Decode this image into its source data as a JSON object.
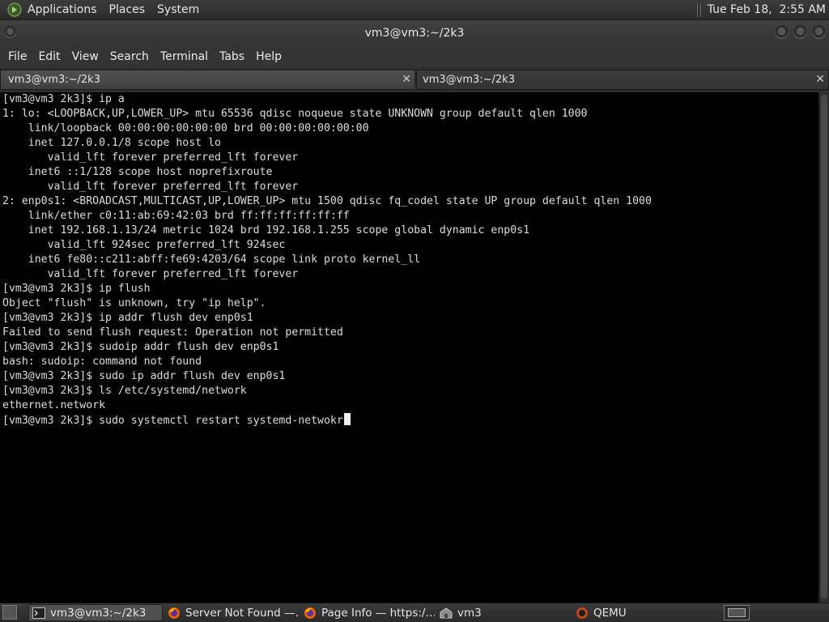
{
  "top_panel": {
    "menus": [
      "Applications",
      "Places",
      "System"
    ],
    "clock": "Tue Feb 18,  2:55 AM"
  },
  "window": {
    "title": "vm3@vm3:~/2k3",
    "menu": [
      "File",
      "Edit",
      "View",
      "Search",
      "Terminal",
      "Tabs",
      "Help"
    ],
    "tabs": [
      {
        "label": "vm3@vm3:~/2k3",
        "close": "✕"
      },
      {
        "label": "vm3@vm3:~/2k3",
        "close": "✕"
      }
    ]
  },
  "terminal": {
    "lines": [
      "[vm3@vm3 2k3]$ ip a",
      "1: lo: <LOOPBACK,UP,LOWER_UP> mtu 65536 qdisc noqueue state UNKNOWN group default qlen 1000",
      "    link/loopback 00:00:00:00:00:00 brd 00:00:00:00:00:00",
      "    inet 127.0.0.1/8 scope host lo",
      "       valid_lft forever preferred_lft forever",
      "    inet6 ::1/128 scope host noprefixroute",
      "       valid_lft forever preferred_lft forever",
      "2: enp0s1: <BROADCAST,MULTICAST,UP,LOWER_UP> mtu 1500 qdisc fq_codel state UP group default qlen 1000",
      "    link/ether c0:11:ab:69:42:03 brd ff:ff:ff:ff:ff:ff",
      "    inet 192.168.1.13/24 metric 1024 brd 192.168.1.255 scope global dynamic enp0s1",
      "       valid_lft 924sec preferred_lft 924sec",
      "    inet6 fe80::c211:abff:fe69:4203/64 scope link proto kernel_ll",
      "       valid_lft forever preferred_lft forever",
      "[vm3@vm3 2k3]$ ip flush",
      "Object \"flush\" is unknown, try \"ip help\".",
      "[vm3@vm3 2k3]$ ip addr flush dev enp0s1",
      "Failed to send flush request: Operation not permitted",
      "[vm3@vm3 2k3]$ sudoip addr flush dev enp0s1",
      "bash: sudoip: command not found",
      "[vm3@vm3 2k3]$ sudo ip addr flush dev enp0s1",
      "[vm3@vm3 2k3]$ ls /etc/systemd/network",
      "ethernet.network",
      "[vm3@vm3 2k3]$ sudo systemctl restart systemd-netwokr"
    ]
  },
  "taskbar": {
    "tasks": [
      {
        "label": "vm3@vm3:~/2k3",
        "icon": "terminal-icon",
        "active": true
      },
      {
        "label": "Server Not Found —…",
        "icon": "firefox-icon",
        "active": false
      },
      {
        "label": "Page Info — https:/…",
        "icon": "firefox-icon",
        "active": false
      },
      {
        "label": "vm3",
        "icon": "folder-home-icon",
        "active": false
      },
      {
        "label": "QEMU",
        "icon": "qemu-icon",
        "active": false
      }
    ]
  }
}
